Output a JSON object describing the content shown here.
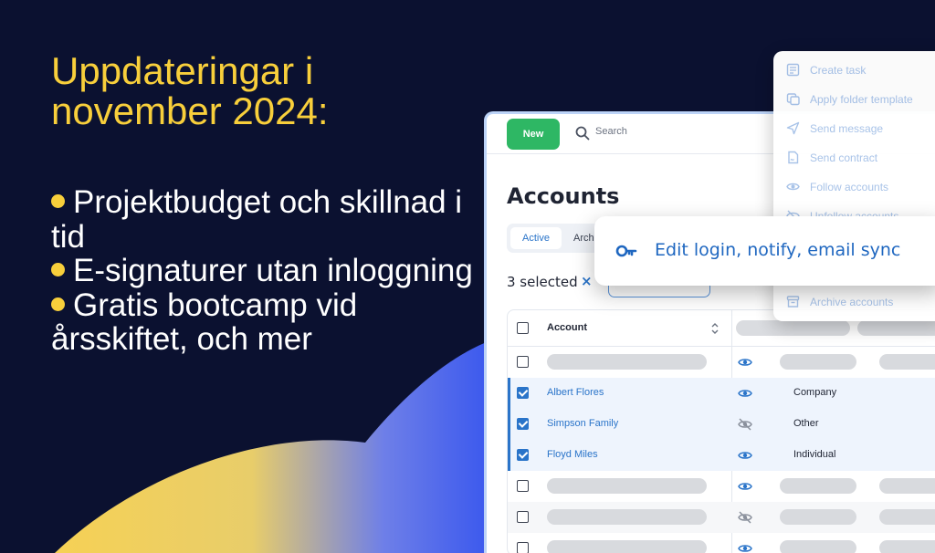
{
  "headline": "Uppdateringar i november 2024:",
  "bullets": [
    "Projektbudget och skillnad i tid",
    "E-signaturer utan inloggning",
    "Gratis bootcamp vid årsskiftet, och mer"
  ],
  "colors": {
    "background": "#0b1130",
    "accent_yellow": "#f8cf3b",
    "primary_blue": "#2a74c9",
    "new_green": "#2eb764"
  },
  "toolbar": {
    "new_label": "New",
    "search_placeholder": "Search"
  },
  "page": {
    "title": "Accounts"
  },
  "tabs": [
    {
      "label": "Active",
      "active": true
    },
    {
      "label": "Arch",
      "active": false
    }
  ],
  "selection": {
    "text": "3 selected",
    "clear_label": "×"
  },
  "table": {
    "header": {
      "account": "Account"
    },
    "rows": [
      {
        "name": "",
        "type": "",
        "checked": false,
        "visible": true
      },
      {
        "name": "Albert Flores",
        "type": "Company",
        "checked": true,
        "visible": true
      },
      {
        "name": "Simpson Family",
        "type": "Other",
        "checked": true,
        "visible": false
      },
      {
        "name": "Floyd Miles",
        "type": "Individual",
        "checked": true,
        "visible": true
      },
      {
        "name": "",
        "type": "",
        "checked": false,
        "visible": true
      },
      {
        "name": "",
        "type": "",
        "checked": false,
        "visible": false
      },
      {
        "name": "",
        "type": "",
        "checked": false,
        "visible": true
      }
    ]
  },
  "menu": {
    "items": [
      {
        "label": "Create task",
        "icon": "task-icon"
      },
      {
        "label": "Apply folder template",
        "icon": "folder-template-icon"
      },
      {
        "label": "Send message",
        "icon": "send-icon"
      },
      {
        "label": "Send contract",
        "icon": "contract-icon"
      },
      {
        "label": "Follow accounts",
        "icon": "eye-icon"
      },
      {
        "label": "Unfollow accounts",
        "icon": "eye-off-icon"
      },
      {
        "label": "Archive accounts",
        "icon": "archive-icon"
      }
    ]
  },
  "callout": {
    "label": "Edit login, notify, email sync",
    "icon": "key-icon"
  }
}
